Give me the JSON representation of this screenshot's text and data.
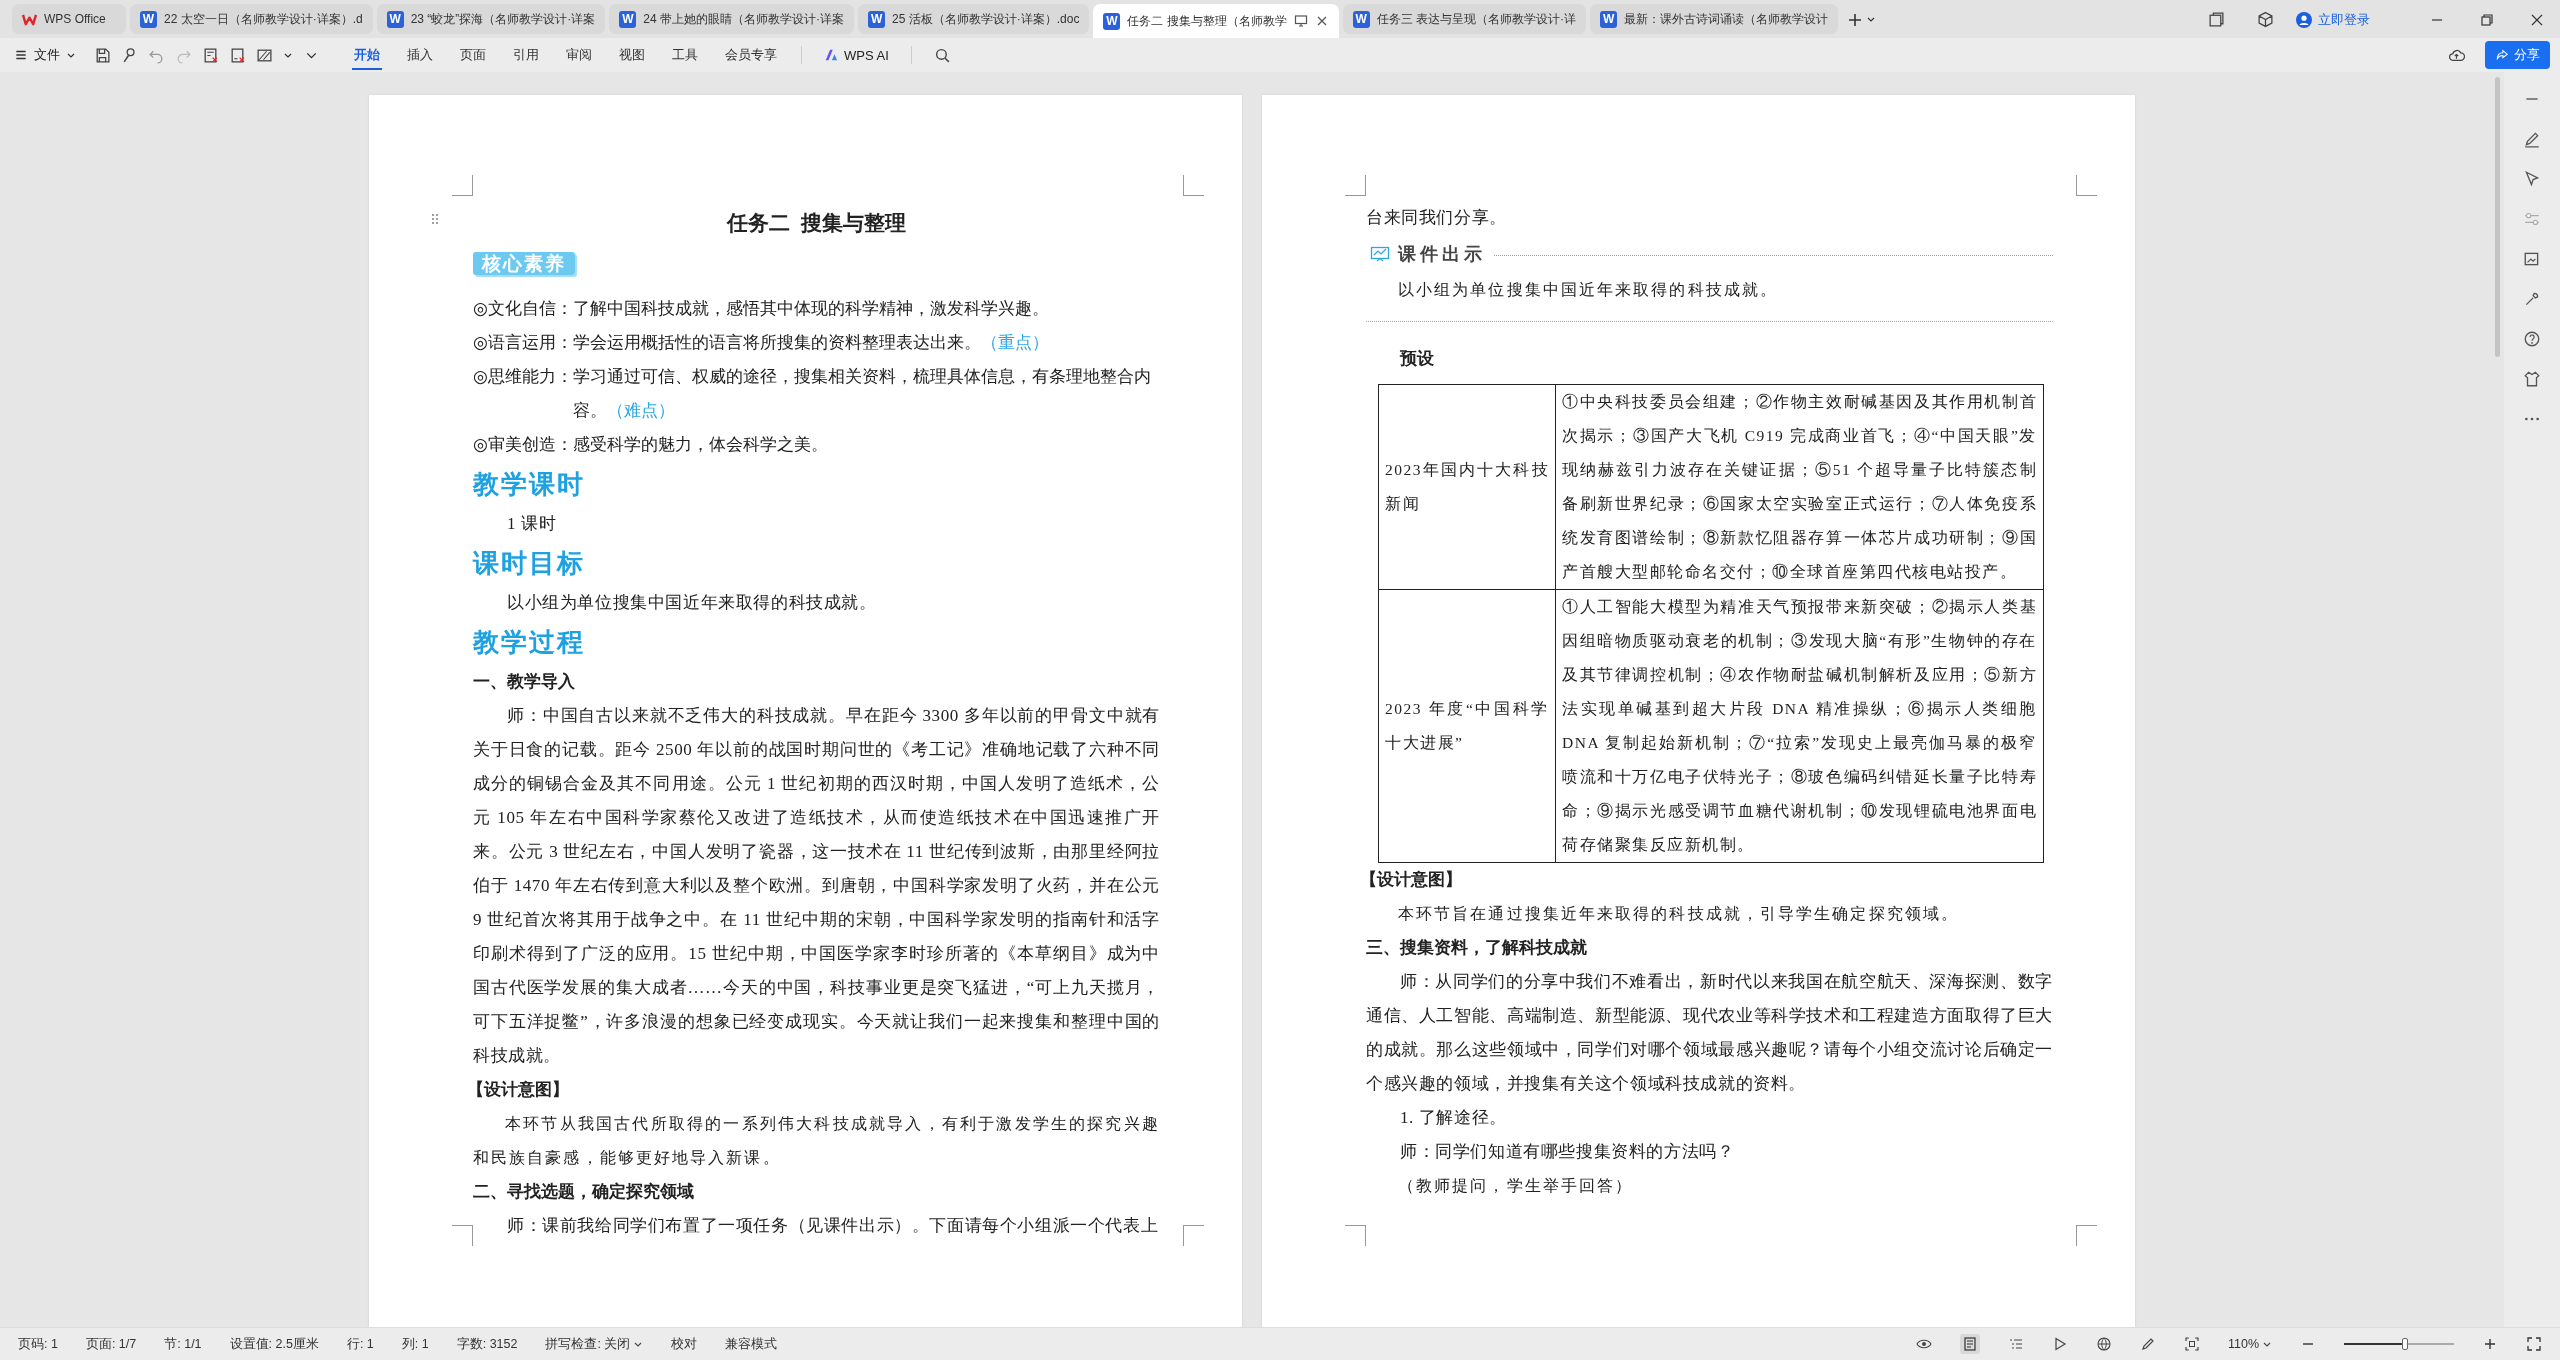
{
  "tabs": [
    {
      "kind": "home",
      "label": "WPS Office",
      "selected": false
    },
    {
      "kind": "doc",
      "badge": "W",
      "label": "22 太空一日（名师教学设计·详案）.d",
      "selected": false
    },
    {
      "kind": "doc",
      "badge": "W",
      "label": "23 “蛟龙”探海（名师教学设计·详案",
      "selected": false
    },
    {
      "kind": "doc",
      "badge": "W",
      "label": "24 带上她的眼睛（名师教学设计·详案",
      "selected": false
    },
    {
      "kind": "doc",
      "badge": "W",
      "label": "25 活板（名师教学设计·详案）.doc",
      "selected": false
    },
    {
      "kind": "doc",
      "badge": "W",
      "label": "任务二 搜集与整理（名师教学",
      "selected": true
    },
    {
      "kind": "doc",
      "badge": "W",
      "label": "任务三 表达与呈现（名师教学设计·详",
      "selected": false
    },
    {
      "kind": "doc",
      "badge": "W",
      "label": "最新：课外古诗词诵读（名师教学设计",
      "selected": false
    }
  ],
  "account": {
    "label": "立即登录"
  },
  "file_menu": "文件",
  "ribbon_tabs": [
    {
      "label": "开始",
      "selected": true
    },
    {
      "label": "插入",
      "selected": false
    },
    {
      "label": "页面",
      "selected": false
    },
    {
      "label": "引用",
      "selected": false
    },
    {
      "label": "审阅",
      "selected": false
    },
    {
      "label": "视图",
      "selected": false
    },
    {
      "label": "工具",
      "selected": false
    },
    {
      "label": "会员专享",
      "selected": false
    }
  ],
  "ai_button": "WPS AI",
  "share_button": "分享",
  "pages": [
    {
      "blocks": [
        {
          "kind": "title",
          "text": "任务二  搜集与整理"
        },
        {
          "kind": "badge",
          "text": "核心素养"
        },
        {
          "kind": "item",
          "label": "◎文化自信：",
          "text": "了解中国科技成就，感悟其中体现的科学精神，激发科学兴趣。"
        },
        {
          "kind": "item",
          "label": "◎语言运用：",
          "text": "学会运用概括性的语言将所搜集的资料整理表达出来。",
          "note": "（重点）"
        },
        {
          "kind": "item",
          "label": "◎思维能力：",
          "text": "学习通过可信、权威的途径，搜集相关资料，梳理具体信息，有条理地整合内容。",
          "note": "（难点）"
        },
        {
          "kind": "item",
          "label": "◎审美创造：",
          "text": "感受科学的魅力，体会科学之美。"
        },
        {
          "kind": "heading",
          "text": "教学课时"
        },
        {
          "kind": "para",
          "indent": true,
          "text": "1 课时"
        },
        {
          "kind": "heading",
          "text": "课时目标"
        },
        {
          "kind": "para",
          "indent": true,
          "text": "以小组为单位搜集中国近年来取得的科技成就。"
        },
        {
          "kind": "heading",
          "text": "教学过程"
        },
        {
          "kind": "subhead",
          "text": "一、教学导入"
        },
        {
          "kind": "para",
          "indent": true,
          "text": "师：中国自古以来就不乏伟大的科技成就。早在距今 3300 多年以前的甲骨文中就有关于日食的记载。距今 2500 年以前的战国时期问世的《考工记》准确地记载了六种不同成分的铜锡合金及其不同用途。公元 1 世纪初期的西汉时期，中国人发明了造纸术，公元 105 年左右中国科学家蔡伦又改进了造纸技术，从而使造纸技术在中国迅速推广开来。公元 3 世纪左右，中国人发明了瓷器，这一技术在 11 世纪传到波斯，由那里经阿拉伯于 1470 年左右传到意大利以及整个欧洲。到唐朝，中国科学家发明了火药，并在公元 9 世纪首次将其用于战争之中。在 11 世纪中期的宋朝，中国科学家发明的指南针和活字印刷术得到了广泛的应用。15 世纪中期，中国医学家李时珍所著的《本草纲目》成为中国古代医学发展的集大成者……今天的中国，科技事业更是突飞猛进，“可上九天揽月，可下五洋捉鳖”，许多浪漫的想象已经变成现实。今天就让我们一起来搜集和整理中国的科技成就。"
        },
        {
          "kind": "label",
          "text": "【设计意图】"
        },
        {
          "kind": "remark",
          "indent": true,
          "text": "本环节从我国古代所取得的一系列伟大科技成就导入，有利于激发学生的探究兴趣和民族自豪感，能够更好地导入新课。"
        },
        {
          "kind": "subhead",
          "text": "二、寻找选题，确定探究领域"
        },
        {
          "kind": "para",
          "indent": true,
          "text": "师：课前我给同学们布置了一项任务（见课件出示）。下面请每个小组派一个代表上"
        }
      ]
    },
    {
      "blocks": [
        {
          "kind": "para",
          "indent": false,
          "text": "台来同我们分享。"
        },
        {
          "kind": "callout",
          "text": "课件出示"
        },
        {
          "kind": "remark",
          "indent": true,
          "text": "以小组为单位搜集中国近年来取得的科技成就。"
        },
        {
          "kind": "rule"
        },
        {
          "kind": "preset",
          "text": "预设"
        },
        {
          "kind": "table",
          "rows": [
            [
              "2023年国内十大科技新闻",
              "①中央科技委员会组建；②作物主效耐碱基因及其作用机制首次揭示；③国产大飞机 C919 完成商业首飞；④“中国天眼”发现纳赫兹引力波存在关键证据；⑤51 个超导量子比特簇态制备刷新世界纪录；⑥国家太空实验室正式运行；⑦人体免疫系统发育图谱绘制；⑧新款忆阻器存算一体芯片成功研制；⑨国产首艘大型邮轮命名交付；⑩全球首座第四代核电站投产。"
            ],
            [
              "2023 年度“中国科学十大进展”",
              "①人工智能大模型为精准天气预报带来新突破；②揭示人类基因组暗物质驱动衰老的机制；③发现大脑“有形”生物钟的存在及其节律调控机制；④农作物耐盐碱机制解析及应用；⑤新方法实现单碱基到超大片段 DNA 精准操纵；⑥揭示人类细胞 DNA 复制起始新机制；⑦“拉索”发现史上最亮伽马暴的极窄喷流和十万亿电子伏特光子；⑧玻色编码纠错延长量子比特寿命；⑨揭示光感受调节血糖代谢机制；⑩发现锂硫电池界面电荷存储聚集反应新机制。"
            ]
          ]
        },
        {
          "kind": "label",
          "text": "【设计意图】"
        },
        {
          "kind": "remark",
          "indent": true,
          "text": "本环节旨在通过搜集近年来取得的科技成就，引导学生确定探究领域。"
        },
        {
          "kind": "subhead",
          "text": "三、搜集资料，了解科技成就"
        },
        {
          "kind": "para",
          "indent": true,
          "text": "师：从同学们的分享中我们不难看出，新时代以来我国在航空航天、深海探测、数字通信、人工智能、高端制造、新型能源、现代农业等科学技术和工程建造方面取得了巨大的成就。那么这些领域中，同学们对哪个领域最感兴趣呢？请每个小组交流讨论后确定一个感兴趣的领域，并搜集有关这个领域科技成就的资料。"
        },
        {
          "kind": "para",
          "indent": true,
          "text": "1. 了解途径。"
        },
        {
          "kind": "para",
          "indent": true,
          "text": "师：同学们知道有哪些搜集资料的方法吗？"
        },
        {
          "kind": "remark",
          "indent": true,
          "text": "（教师提问，学生举手回答）"
        }
      ]
    }
  ],
  "status_bar": [
    {
      "text": "页码: 1",
      "dropdown": false
    },
    {
      "text": "页面: 1/7",
      "dropdown": false
    },
    {
      "text": "节: 1/1",
      "dropdown": false
    },
    {
      "text": "设置值: 2.5厘米",
      "dropdown": false
    },
    {
      "text": "行: 1",
      "dropdown": false
    },
    {
      "text": "列: 1",
      "dropdown": false
    },
    {
      "text": "字数: 3152",
      "dropdown": false
    },
    {
      "text": "拼写检查: 关闭",
      "dropdown": true
    },
    {
      "text": "校对",
      "dropdown": false
    },
    {
      "text": "兼容模式",
      "dropdown": false
    }
  ],
  "zoom": {
    "label": "110%",
    "level": 0.55
  }
}
